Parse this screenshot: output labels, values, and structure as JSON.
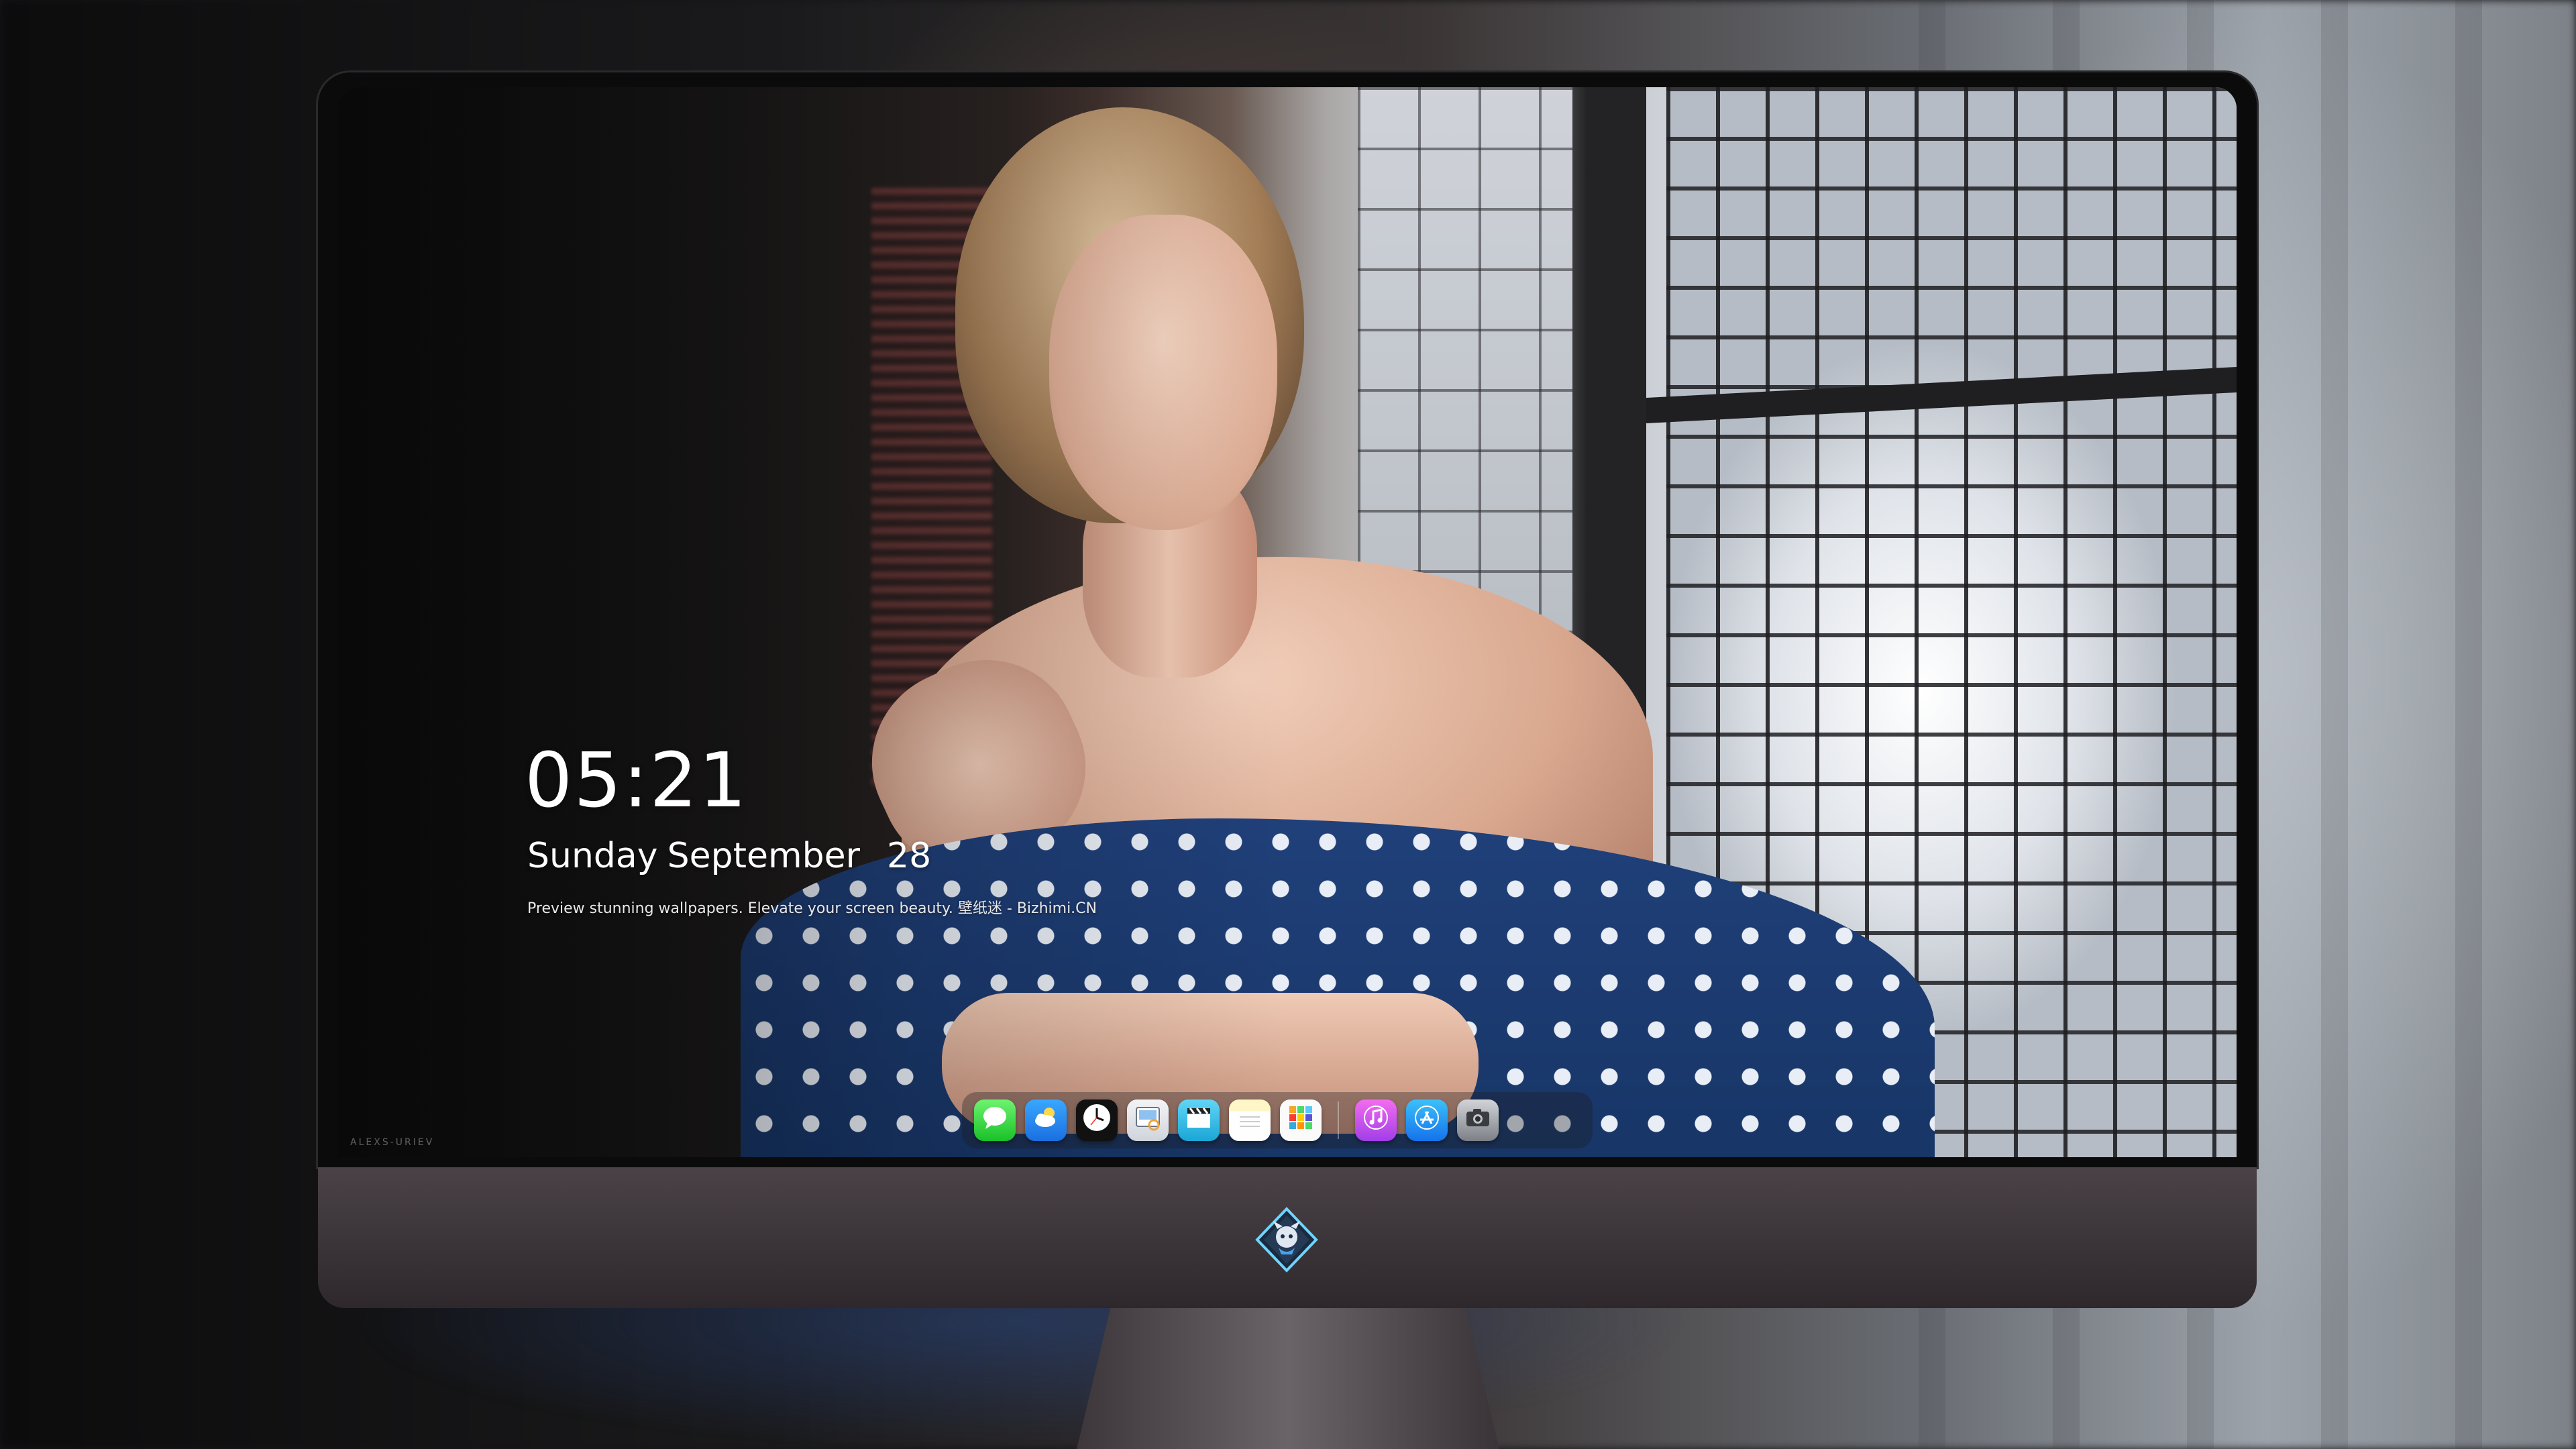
{
  "lockscreen": {
    "time": "05:21",
    "weekday": "Sunday",
    "month": "September",
    "day": "28",
    "tagline": "Preview stunning wallpapers. Elevate your screen beauty. 壁纸迷 - Bizhimi.CN",
    "watermark": "ALEXS-URIEV"
  },
  "dock": {
    "items": [
      {
        "name": "messages",
        "icon": "chat-bubble-icon",
        "color": "#2bd43b"
      },
      {
        "name": "weather",
        "icon": "cloud-icon",
        "color": "#2a8cf2"
      },
      {
        "name": "clock",
        "icon": "clock-icon",
        "color": "#111111"
      },
      {
        "name": "preview",
        "icon": "preview-icon",
        "color": "#e4e7ec"
      },
      {
        "name": "video",
        "icon": "clapperboard-icon",
        "color": "#33bce6"
      },
      {
        "name": "notes",
        "icon": "notes-icon",
        "color": "#fff6c7"
      },
      {
        "name": "photos",
        "icon": "photos-grid-icon",
        "color": "#fafafa"
      },
      {
        "name": "music",
        "icon": "music-note-icon",
        "color": "#c94bee"
      },
      {
        "name": "app-store",
        "icon": "app-store-icon",
        "color": "#1f8ff2"
      },
      {
        "name": "camera",
        "icon": "camera-icon",
        "color": "#a3a6ab"
      }
    ]
  },
  "monitor": {
    "logo": "monitor-brand-logo-icon"
  },
  "colors": {
    "chin": "#3b3438",
    "dress": "#1d3b72",
    "text": "#ffffff"
  }
}
